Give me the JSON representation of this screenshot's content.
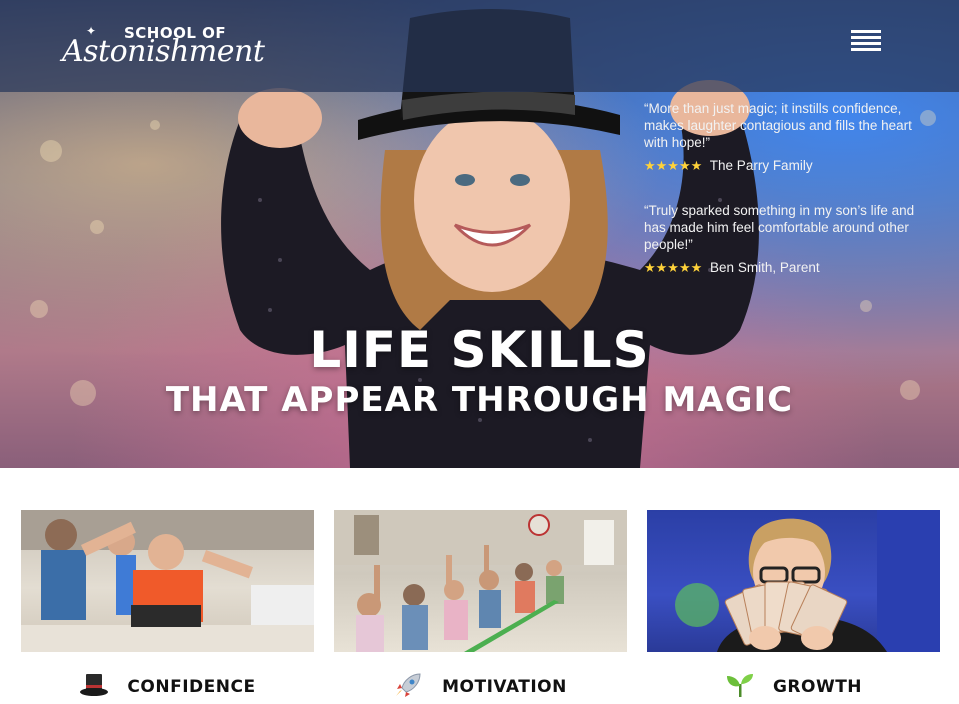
{
  "header": {
    "logo_top": "SCHOOL OF",
    "logo_main": "Astonishment",
    "menu_icon": "hamburger-menu-icon"
  },
  "testimonials": [
    {
      "quote": "“More than just magic; it instills confidence, makes laughter contagious and fills the heart with hope!”",
      "stars": "★★★★★",
      "author": "The Parry Family"
    },
    {
      "quote": "“Truly sparked something in my son’s life and has made him feel comfortable around other people!”",
      "stars": "★★★★★",
      "author": "Ben Smith, Parent"
    }
  ],
  "hero": {
    "headline_1": "LIFE SKILLS",
    "headline_2": "THAT APPEAR THROUGH MAGIC"
  },
  "features": [
    {
      "label": "CONFIDENCE",
      "icon": "top-hat-icon"
    },
    {
      "label": "MOTIVATION",
      "icon": "rocket-icon"
    },
    {
      "label": "GROWTH",
      "icon": "seedling-icon"
    }
  ],
  "colors": {
    "topbar": "#28375a",
    "star": "#ffd23a",
    "caption_text": "#111111"
  }
}
